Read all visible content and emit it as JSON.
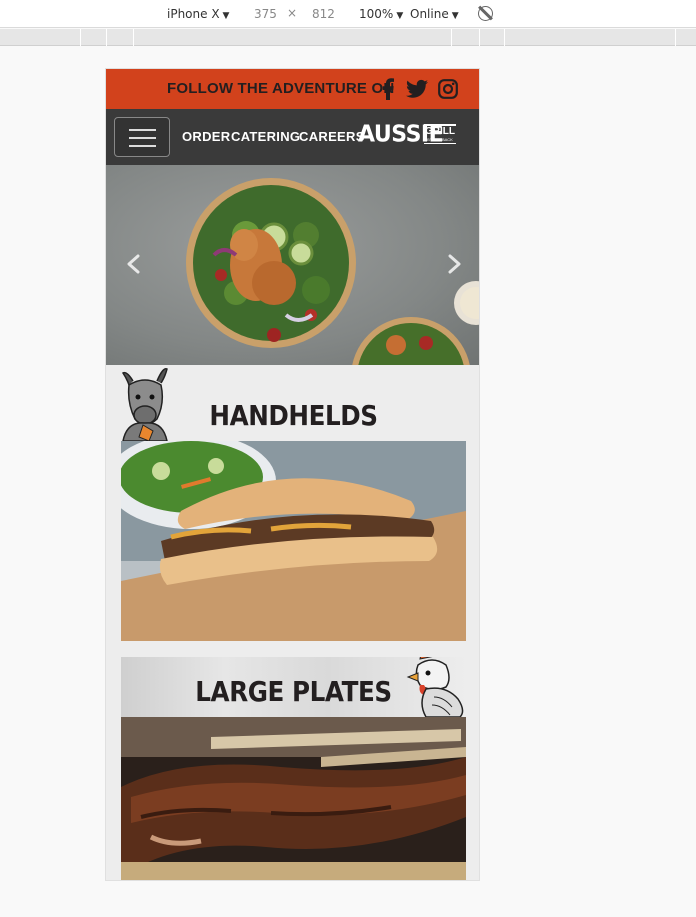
{
  "devtools": {
    "device": "iPhone X",
    "width": "375",
    "times": "×",
    "height": "812",
    "zoom": "100%",
    "network": "Online",
    "rotate_icon": "rotate-icon"
  },
  "follow": {
    "text": "FOLLOW THE ADVENTURE ON",
    "icons": [
      "facebook-icon",
      "twitter-icon",
      "instagram-icon"
    ],
    "bg_color": "#d2421c"
  },
  "nav": {
    "links": [
      "ORDER",
      "CATERING",
      "CAREERS"
    ],
    "logo_main": "AUSSIE",
    "logo_grill": "GRILL",
    "logo_sub": "BY OUTBACK",
    "bg_color": "#3a3a3a"
  },
  "hero": {
    "slide_count": 2,
    "active_slide": 2
  },
  "sections": [
    {
      "title": "HANDHELDS"
    },
    {
      "title": "LARGE PLATES"
    }
  ]
}
